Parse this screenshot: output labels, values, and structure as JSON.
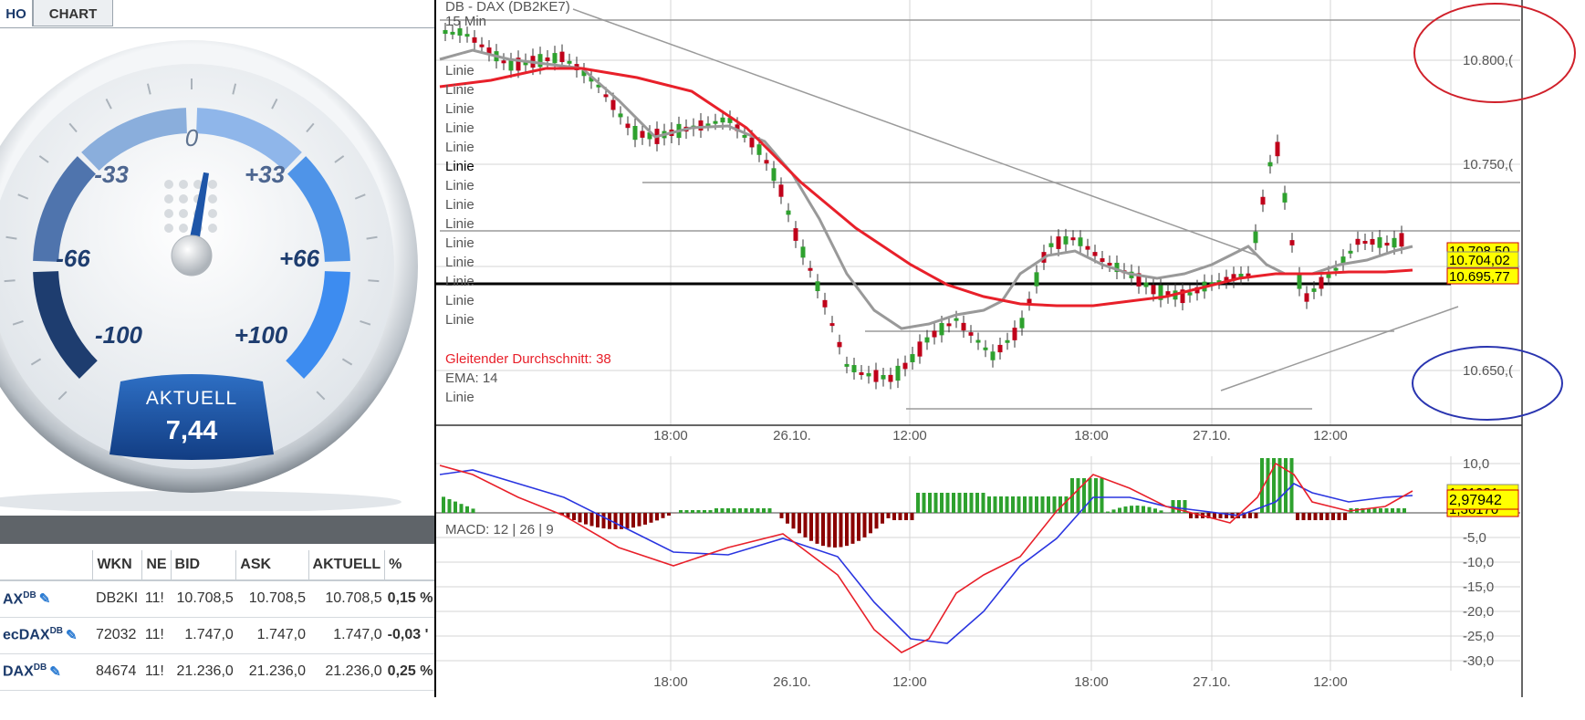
{
  "tabs": {
    "info": "HO",
    "chart": "CHART"
  },
  "gauge": {
    "value": 7.44,
    "scale_labels": [
      "0",
      "-33",
      "+33",
      "-66",
      "+66",
      "-100",
      "+100"
    ],
    "aktuell_label": "AKTUELL",
    "aktuell_value": "7,44"
  },
  "table": {
    "headers": [
      "",
      "WKN",
      "NE",
      "BID",
      "ASK",
      "AKTUELL",
      "%"
    ],
    "rows": [
      {
        "name": "AX",
        "sup": "DB",
        "wkn": "DB2KI",
        "ne": "11!",
        "bid": "10.708,5",
        "ask": "10.708,5",
        "aktuell": "10.708,5",
        "pct": "0,15 %"
      },
      {
        "name": "ecDAX",
        "sup": "DB",
        "wkn": "72032",
        "ne": "11!",
        "bid": "1.747,0",
        "ask": "1.747,0",
        "aktuell": "1.747,0",
        "pct": "-0,03 '"
      },
      {
        "name": "DAX",
        "sup": "DB",
        "wkn": "84674",
        "ne": "11!",
        "bid": "21.236,0",
        "ask": "21.236,0",
        "aktuell": "21.236,0",
        "pct": "0,25 %"
      }
    ]
  },
  "chart": {
    "title": "DB - DAX (DB2KE7)",
    "interval": "15 Min",
    "legend_lines": [
      "Linie",
      "Linie",
      "Linie",
      "Linie",
      "Linie",
      "Linie",
      "Linie",
      "Linie",
      "Linie",
      "Linie",
      "Linie",
      "Linie",
      "Linie",
      "Linie"
    ],
    "legend_ma": "Gleitender Durchschnitt: 38",
    "legend_ema": "EMA: 14",
    "legend_last": "Linie",
    "y_labels": [
      "10.800,(",
      "10.750,(",
      "10.650,("
    ],
    "price_tags": [
      "10.708,50",
      "10.704,02",
      "10.695,77"
    ],
    "x_labels": [
      "18:00",
      "26.10.",
      "12:00",
      "18:00",
      "27.10.",
      "12:00"
    ],
    "colors": {
      "up": "#2ea12e",
      "down": "#c0001a",
      "ma": "#e8202a",
      "ema": "#9a9a9a",
      "tag": "#ffff00"
    }
  },
  "macd": {
    "label": "MACD: 12 | 26 | 9",
    "y_labels": [
      "10,0",
      "-5,0",
      "-10,0",
      "-15,0",
      "-20,0",
      "-25,0",
      "-30,0"
    ],
    "tags": [
      "1,61981",
      "2,97942",
      "1,36170"
    ],
    "x_labels": [
      "18:00",
      "26.10.",
      "12:00",
      "18:00",
      "27.10.",
      "12:00"
    ]
  }
}
